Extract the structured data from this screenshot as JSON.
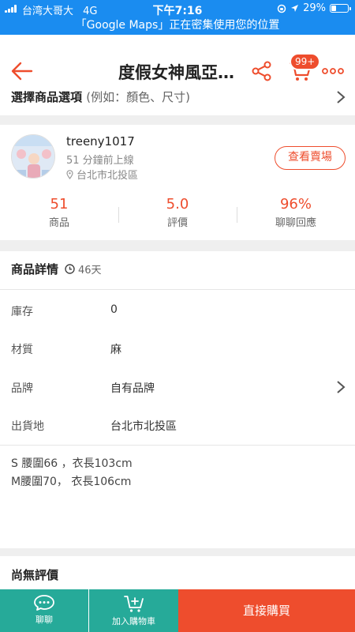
{
  "status_bar": {
    "carrier": "台湾大哥大",
    "network": "4G",
    "time": "下午7:16",
    "battery": "29%",
    "battery_level": 0.29,
    "location_banner": "「Google Maps」正在密集使用您的位置"
  },
  "nav": {
    "title": "度假女神風亞麻洋裝",
    "cart_badge": "99+"
  },
  "options": {
    "title": "選擇商品選項",
    "hint": "(例如：顏色、尺寸)"
  },
  "seller": {
    "name": "treeny1017",
    "last_online": "51 分鐘前上線",
    "location": "台北市北投區",
    "view_shop_label": "查看賣場",
    "stats": [
      {
        "value": "51",
        "label": "商品"
      },
      {
        "value": "5.0",
        "label": "評價"
      },
      {
        "value": "96%",
        "label": "聊聊回應"
      }
    ]
  },
  "details": {
    "title": "商品詳情",
    "age": "46天",
    "specs": [
      {
        "label": "庫存",
        "value": "0"
      },
      {
        "label": "材質",
        "value": "麻"
      },
      {
        "label": "品牌",
        "value": "自有品牌"
      },
      {
        "label": "出貨地",
        "value": "台北市北投區"
      }
    ],
    "description_lines": [
      "S 腰圍66 ，衣長103cm",
      "M腰圍70， 衣長106cm"
    ]
  },
  "reviews": {
    "title": "尚無評價"
  },
  "bottom_bar": {
    "chat_label": "聊聊",
    "add_to_cart_label": "加入購物車",
    "buy_now_label": "直接購買"
  },
  "colors": {
    "status_blue": "#1a8cf0",
    "brand_orange": "#ee4d2d",
    "teal": "#26aa99",
    "section_gap": "#efefef"
  }
}
